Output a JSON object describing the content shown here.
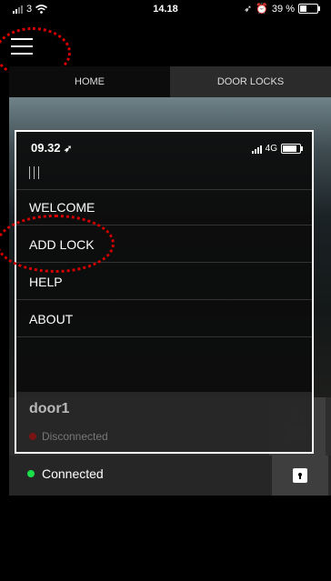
{
  "status_bar": {
    "carrier": "3",
    "time": "14.18",
    "battery": "39 %",
    "battery_level": 0.39
  },
  "tabs": [
    {
      "label": "HOME"
    },
    {
      "label": "DOOR LOCKS"
    }
  ],
  "lock_row": {
    "status": "Connected"
  },
  "overlay": {
    "time": "09.32",
    "network": "4G",
    "menu": [
      {
        "label": "WELCOME"
      },
      {
        "label": "ADD LOCK"
      },
      {
        "label": "HELP"
      },
      {
        "label": "ABOUT"
      }
    ],
    "door": {
      "name": "door1",
      "status": "Disconnected"
    }
  },
  "colors": {
    "connected": "#19e04a",
    "disconnected": "#7a1313",
    "hint": "#d40000"
  },
  "icons": [
    "signal-icon",
    "wifi-icon",
    "location-arrow-icon",
    "alarm-icon",
    "battery-icon",
    "hamburger-menu-icon",
    "padlock-icon"
  ]
}
